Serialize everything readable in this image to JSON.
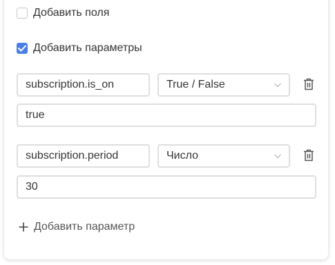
{
  "add_fields": {
    "label": "Добавить поля",
    "checked": false
  },
  "add_params": {
    "label": "Добавить параметры",
    "checked": true
  },
  "params": [
    {
      "key": "subscription.is_on",
      "type": "True / False",
      "value": "true"
    },
    {
      "key": "subscription.period",
      "type": "Число",
      "value": "30"
    }
  ],
  "add_param_button": {
    "label": "Добавить параметр"
  },
  "icons": {
    "checkbox_check": "check-icon",
    "dropdown": "chevron-down-icon",
    "delete": "trash-icon",
    "add": "plus-icon"
  },
  "colors": {
    "accent": "#4a7ee8",
    "border": "#dedede",
    "text": "#333333",
    "icon": "#555555"
  }
}
